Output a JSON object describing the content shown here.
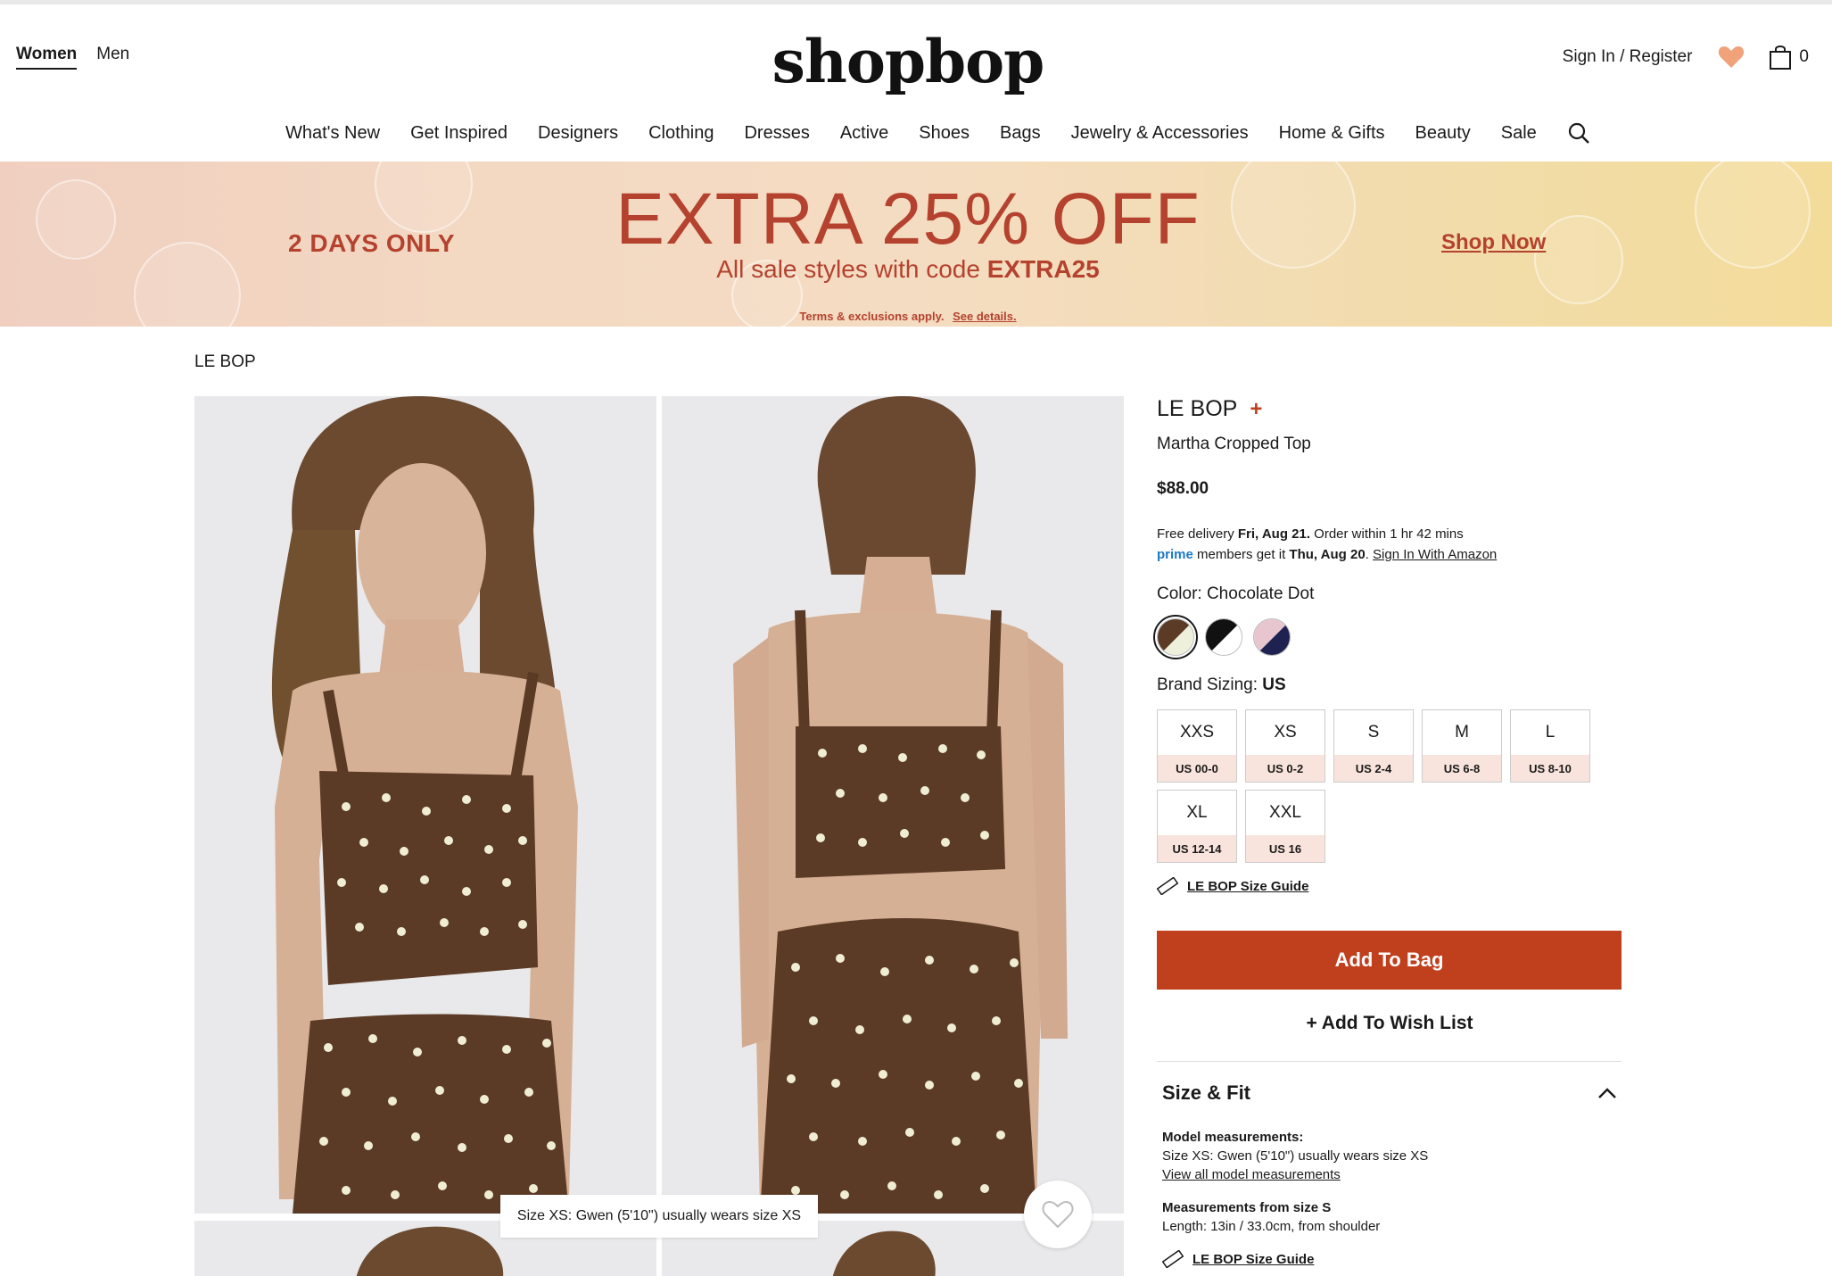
{
  "header": {
    "gender_tabs": [
      "Women",
      "Men"
    ],
    "logo": "shopbop",
    "sign_in": "Sign In / Register",
    "bag_count": "0"
  },
  "nav": {
    "items": [
      "What's New",
      "Get Inspired",
      "Designers",
      "Clothing",
      "Dresses",
      "Active",
      "Shoes",
      "Bags",
      "Jewelry & Accessories",
      "Home & Gifts",
      "Beauty",
      "Sale"
    ]
  },
  "banner": {
    "left": "2 DAYS ONLY",
    "headline": "EXTRA 25% OFF",
    "sub_text": "All sale styles with code",
    "code": "EXTRA25",
    "terms": "Terms & exclusions apply.",
    "terms_link": "See details.",
    "cta": "Shop Now",
    "text_color": "#b4422e"
  },
  "breadcrumb": "LE BOP",
  "gallery": {
    "caption": "Size XS: Gwen (5'10\") usually wears size XS"
  },
  "product": {
    "brand": "LE BOP",
    "brand_follow": "+",
    "name": "Martha Cropped Top",
    "price": "$88.00",
    "delivery_prefix": "Free delivery",
    "delivery_date": "Fri, Aug 21.",
    "delivery_suffix": "Order within 1 hr 42 mins",
    "prime_label": "prime",
    "prime_prefix": "members get it",
    "prime_date": "Thu, Aug 20",
    "prime_link": "Sign In With Amazon",
    "color_label": "Color: Chocolate Dot",
    "swatches": [
      {
        "name": "Chocolate Dot",
        "c1": "#5b3a26",
        "c2": "#eef0dc"
      },
      {
        "name": "Black White",
        "c1": "#111111",
        "c2": "#ffffff"
      },
      {
        "name": "Pink Navy",
        "c1": "#e8c6d0",
        "c2": "#1e2250"
      }
    ],
    "sizing_label": "Brand Sizing:",
    "sizing_value": "US",
    "sizes": [
      {
        "label": "XXS",
        "us": "US 00-0"
      },
      {
        "label": "XS",
        "us": "US 0-2"
      },
      {
        "label": "S",
        "us": "US 2-4"
      },
      {
        "label": "M",
        "us": "US 6-8"
      },
      {
        "label": "L",
        "us": "US 8-10"
      },
      {
        "label": "XL",
        "us": "US 12-14"
      },
      {
        "label": "XXL",
        "us": "US 16"
      }
    ],
    "size_guide": "LE BOP Size Guide",
    "add_to_bag": "Add To Bag",
    "add_to_wishlist": "+ Add To Wish List",
    "accent": "#c0401e"
  },
  "size_fit": {
    "title": "Size & Fit",
    "model_label": "Model measurements:",
    "model_text": "Size XS: Gwen (5'10\") usually wears size XS",
    "model_link": "View all model measurements",
    "meas_label": "Measurements from size S",
    "meas_text": "Length: 13in / 33.0cm, from shoulder",
    "size_guide": "LE BOP Size Guide"
  }
}
